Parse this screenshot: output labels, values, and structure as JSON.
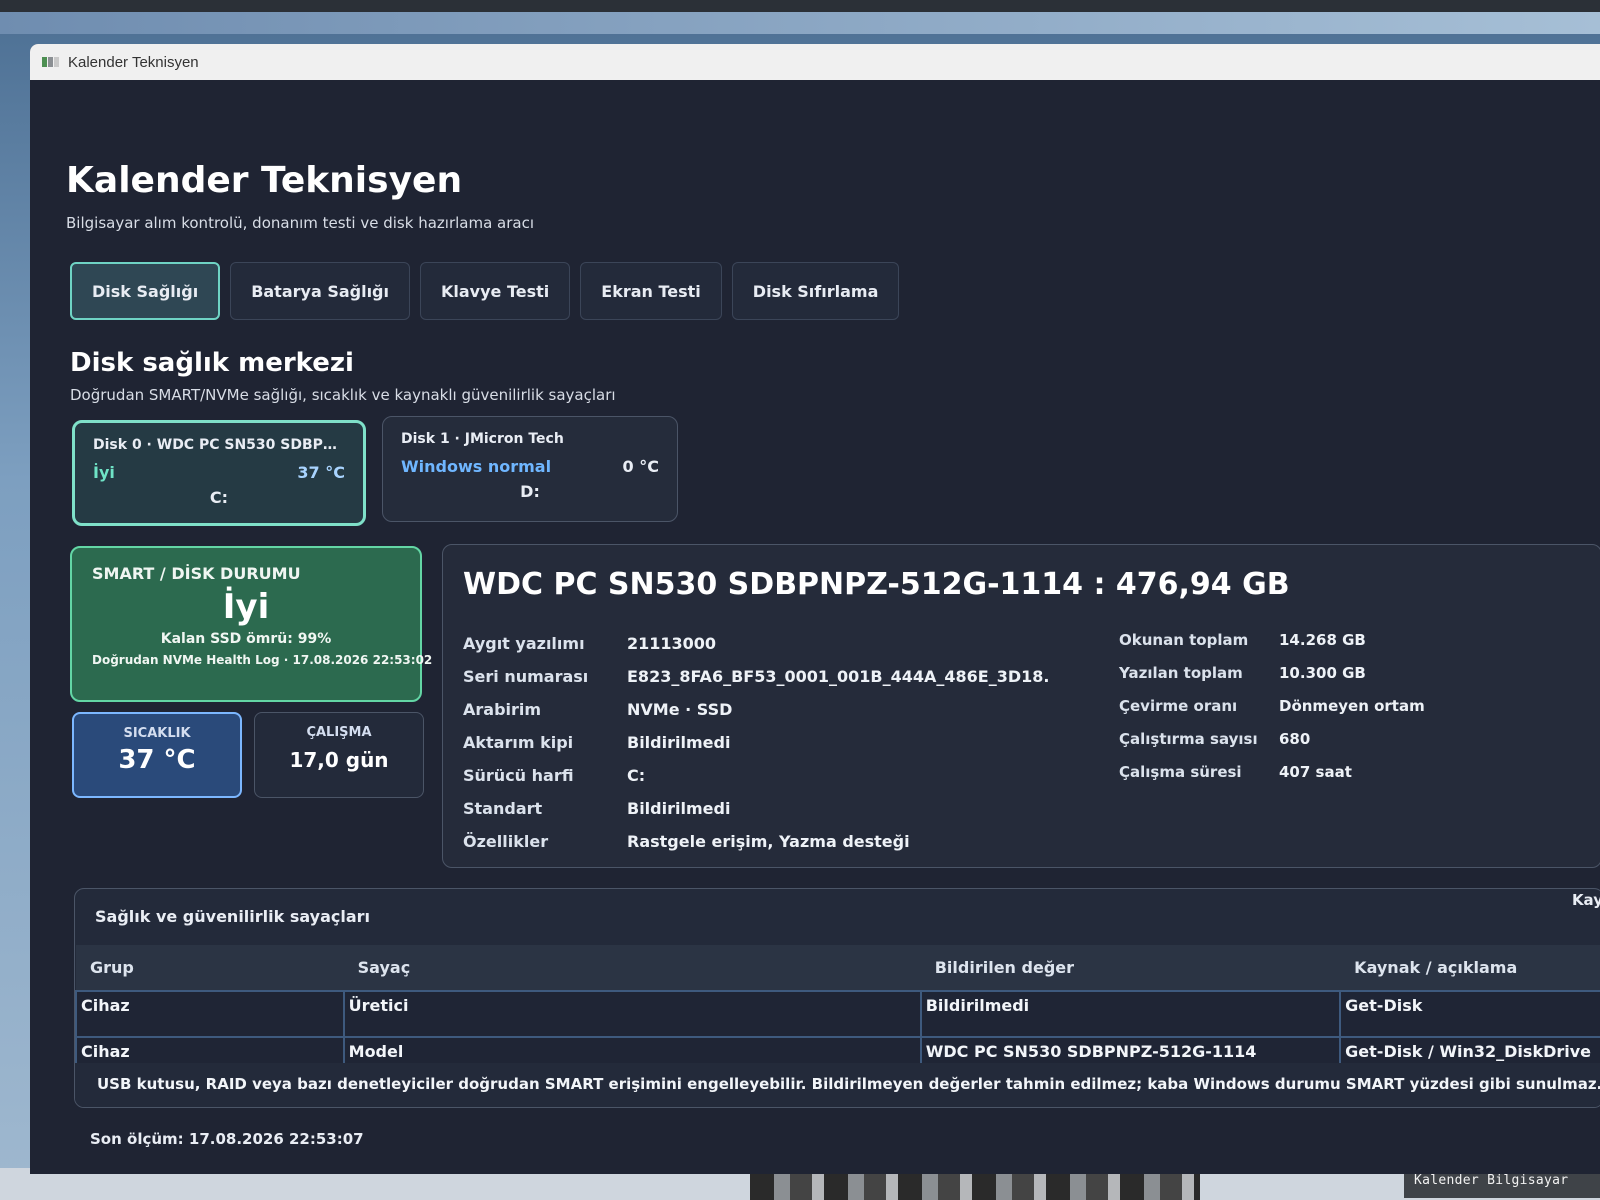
{
  "window": {
    "title": "Kalender Teknisyen"
  },
  "header": {
    "title": "Kalender Teknisyen",
    "subtitle": "Bilgisayar alım kontrolü, donanım testi ve disk hazırlama aracı"
  },
  "tabs": [
    {
      "label": "Disk Sağlığı",
      "active": true
    },
    {
      "label": "Batarya Sağlığı",
      "active": false
    },
    {
      "label": "Klavye Testi",
      "active": false
    },
    {
      "label": "Ekran Testi",
      "active": false
    },
    {
      "label": "Disk Sıfırlama",
      "active": false
    }
  ],
  "section": {
    "title": "Disk sağlık merkezi",
    "subtitle": "Doğrudan SMART/NVMe sağlığı, sıcaklık ve kaynaklı güvenilirlik sayaçları"
  },
  "disks": [
    {
      "title": "Disk 0 · WDC PC SN530 SDBPNPZ-...",
      "status": "İyi",
      "temp": "37 °C",
      "letter": "C:"
    },
    {
      "title": "Disk 1 · JMicron Tech",
      "status": "Windows normal",
      "temp": "0 °C",
      "letter": "D:"
    }
  ],
  "smart": {
    "label": "SMART / DİSK DURUMU",
    "status": "İyi",
    "life": "Kalan SSD ömrü: 99%",
    "log": "Doğrudan NVMe Health Log · 17.08.2026 22:53:02"
  },
  "stats": {
    "temp_label": "SICAKLIK",
    "temp_value": "37 °C",
    "run_label": "ÇALIŞMA",
    "run_value": "17,0 gün"
  },
  "detail": {
    "title": "WDC PC SN530 SDBPNPZ-512G-1114 : 476,94 GB",
    "left": [
      {
        "key": "Aygıt yazılımı",
        "value": "21113000"
      },
      {
        "key": "Seri numarası",
        "value": "E823_8FA6_BF53_0001_001B_444A_486E_3D18."
      },
      {
        "key": "Arabirim",
        "value": "NVMe · SSD"
      },
      {
        "key": "Aktarım kipi",
        "value": "Bildirilmedi"
      },
      {
        "key": "Sürücü harfi",
        "value": "C:"
      },
      {
        "key": "Standart",
        "value": "Bildirilmedi"
      },
      {
        "key": "Özellikler",
        "value": "Rastgele erişim, Yazma desteği"
      }
    ],
    "right": [
      {
        "key": "Okunan toplam",
        "value": "14.268 GB"
      },
      {
        "key": "Yazılan toplam",
        "value": "10.300 GB"
      },
      {
        "key": "Çevirme oranı",
        "value": "Dönmeyen ortam"
      },
      {
        "key": "Çalıştırma sayısı",
        "value": "680"
      },
      {
        "key": "Çalışma süresi",
        "value": "407 saat"
      }
    ]
  },
  "counters": {
    "title": "Sağlık ve güvenilirlik sayaçları",
    "corner_label": "Kay",
    "headers": [
      "Grup",
      "Sayaç",
      "Bildirilen değer",
      "Kaynak / açıklama"
    ],
    "rows": [
      [
        "Cihaz",
        "Üretici",
        "Bildirilmedi",
        "Get-Disk"
      ],
      [
        "Cihaz",
        "Model",
        "WDC PC SN530 SDBPNPZ-512G-1114",
        "Get-Disk / Win32_DiskDrive"
      ]
    ],
    "note": "USB kutusu, RAID veya bazı denetleyiciler doğrudan SMART erişimini engelleyebilir. Bildirilmeyen değerler tahmin edilmez; kaba Windows durumu SMART yüzdesi gibi sunulmaz."
  },
  "footer": {
    "last_measure": "Son ölçüm: 17.08.2026 22:53:07"
  },
  "watermark": {
    "text": "Kalender Bilgisayar"
  },
  "colors": {
    "accent_teal": "#7fe0c9",
    "good_green": "#2c6a4f",
    "temp_blue": "#2a4a7a",
    "background": "#1f2433"
  }
}
